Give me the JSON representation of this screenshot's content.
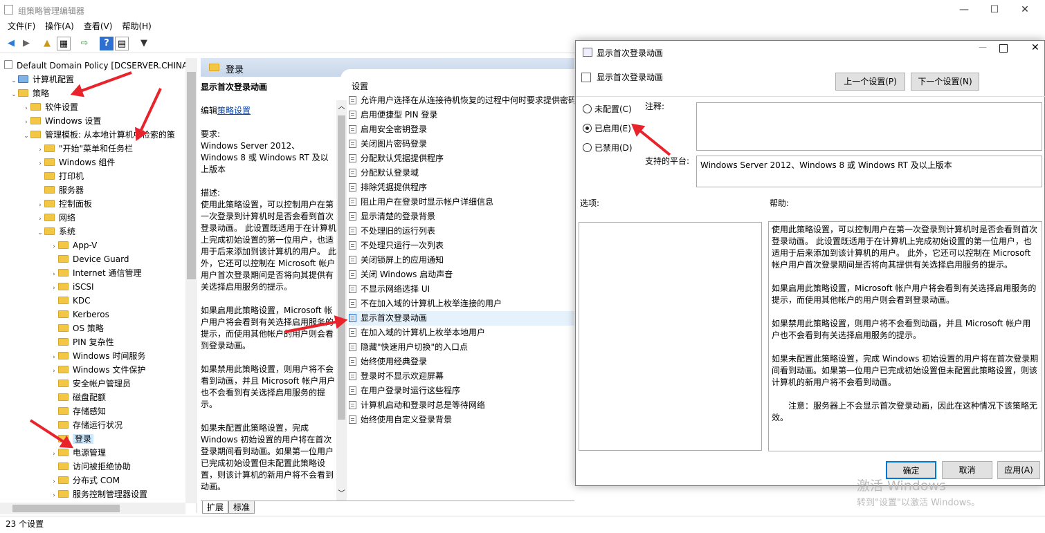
{
  "window": {
    "title": "组策略管理编辑器",
    "min": "—",
    "max": "☐",
    "close": "✕"
  },
  "menu": [
    "文件(F)",
    "操作(A)",
    "查看(V)",
    "帮助(H)"
  ],
  "toolbar_icons": [
    "back-icon",
    "forward-icon",
    "up-folder-icon",
    "show-hide-tree-icon",
    "export-icon",
    "help-icon",
    "properties-icon",
    "filter-icon"
  ],
  "tree": [
    {
      "label": "Default Domain Policy [DCSERVER.CHINA",
      "lvl": 0,
      "caret": "",
      "icon": "policy"
    },
    {
      "label": "计算机配置",
      "lvl": 0,
      "caret": "⌄",
      "icon": "computer"
    },
    {
      "label": "策略",
      "lvl": 1,
      "caret": "⌄",
      "icon": "folder"
    },
    {
      "label": "软件设置",
      "lvl": 2,
      "caret": "›",
      "icon": "folder"
    },
    {
      "label": "Windows 设置",
      "lvl": 2,
      "caret": "›",
      "icon": "folder"
    },
    {
      "label": "管理模板: 从本地计算机中检索的策",
      "lvl": 2,
      "caret": "⌄",
      "icon": "folder"
    },
    {
      "label": "\"开始\"菜单和任务栏",
      "lvl": 3,
      "caret": "›",
      "icon": "folder"
    },
    {
      "label": "Windows 组件",
      "lvl": 3,
      "caret": "›",
      "icon": "folder"
    },
    {
      "label": "打印机",
      "lvl": 3,
      "caret": "",
      "icon": "folder"
    },
    {
      "label": "服务器",
      "lvl": 3,
      "caret": "",
      "icon": "folder"
    },
    {
      "label": "控制面板",
      "lvl": 3,
      "caret": "›",
      "icon": "folder"
    },
    {
      "label": "网络",
      "lvl": 3,
      "caret": "›",
      "icon": "folder"
    },
    {
      "label": "系统",
      "lvl": 3,
      "caret": "⌄",
      "icon": "folder"
    },
    {
      "label": "App-V",
      "lvl": 4,
      "caret": "›",
      "icon": "folder"
    },
    {
      "label": "Device Guard",
      "lvl": 4,
      "caret": "",
      "icon": "folder"
    },
    {
      "label": "Internet 通信管理",
      "lvl": 4,
      "caret": "›",
      "icon": "folder"
    },
    {
      "label": "iSCSI",
      "lvl": 4,
      "caret": "›",
      "icon": "folder"
    },
    {
      "label": "KDC",
      "lvl": 4,
      "caret": "",
      "icon": "folder"
    },
    {
      "label": "Kerberos",
      "lvl": 4,
      "caret": "",
      "icon": "folder"
    },
    {
      "label": "OS 策略",
      "lvl": 4,
      "caret": "",
      "icon": "folder"
    },
    {
      "label": "PIN 复杂性",
      "lvl": 4,
      "caret": "",
      "icon": "folder"
    },
    {
      "label": "Windows 时间服务",
      "lvl": 4,
      "caret": "›",
      "icon": "folder"
    },
    {
      "label": "Windows 文件保护",
      "lvl": 4,
      "caret": "›",
      "icon": "folder"
    },
    {
      "label": "安全帐户管理员",
      "lvl": 4,
      "caret": "",
      "icon": "folder"
    },
    {
      "label": "磁盘配额",
      "lvl": 4,
      "caret": "",
      "icon": "folder"
    },
    {
      "label": "存储感知",
      "lvl": 4,
      "caret": "",
      "icon": "folder"
    },
    {
      "label": "存储运行状况",
      "lvl": 4,
      "caret": "",
      "icon": "folder"
    },
    {
      "label": "登录",
      "lvl": 4,
      "caret": "",
      "icon": "folder",
      "selected": true
    },
    {
      "label": "电源管理",
      "lvl": 4,
      "caret": "›",
      "icon": "folder"
    },
    {
      "label": "访问被拒绝协助",
      "lvl": 4,
      "caret": "",
      "icon": "folder"
    },
    {
      "label": "分布式 COM",
      "lvl": 4,
      "caret": "›",
      "icon": "folder"
    },
    {
      "label": "服务控制管理器设置",
      "lvl": 4,
      "caret": "›",
      "icon": "folder"
    }
  ],
  "middle": {
    "header": "登录",
    "desc_title": "显示首次登录动画",
    "edit_prefix": "编辑",
    "edit_link": "策略设置",
    "req_label": "要求:",
    "req_text": "Windows Server 2012、Windows 8 或 Windows RT 及以上版本",
    "desc_label": "描述:",
    "desc_paras": [
      "使用此策略设置，可以控制用户在第一次登录到计算机时是否会看到首次登录动画。 此设置既适用于在计算机上完成初始设置的第一位用户，也适用于后来添加到该计算机的用户。 此外，它还可以控制在 Microsoft 帐户用户首次登录期间是否将向其提供有关选择启用服务的提示。",
      "如果启用此策略设置，Microsoft 帐户用户将会看到有关选择启用服务的提示，而使用其他帐户的用户则会看到登录动画。",
      "如果禁用此策略设置，则用户将不会看到动画，并且 Microsoft 帐户用户也不会看到有关选择启用服务的提示。",
      "如果未配置此策略设置，完成 Windows 初始设置的用户将在首次登录期间看到动画。如果第一位用户已完成初始设置但未配置此策略设置，则该计算机的新用户将不会看到动画。"
    ],
    "list_header": "设置",
    "settings": [
      "允许用户选择在从连接待机恢复的过程中何时要求提供密码",
      "启用便捷型 PIN 登录",
      "启用安全密钥登录",
      "关闭图片密码登录",
      "分配默认凭据提供程序",
      "分配默认登录域",
      "排除凭据提供程序",
      "阻止用户在登录时显示帐户详细信息",
      "显示清楚的登录背景",
      "不处理旧的运行列表",
      "不处理只运行一次列表",
      "关闭锁屏上的应用通知",
      "关闭 Windows 启动声音",
      "不显示网络选择 UI",
      "不在加入域的计算机上枚举连接的用户",
      "显示首次登录动画",
      "在加入域的计算机上枚举本地用户",
      "隐藏\"快速用户切换\"的入口点",
      "始终使用经典登录",
      "登录时不显示欢迎屏幕",
      "在用户登录时运行这些程序",
      "计算机启动和登录时总是等待网络",
      "始终使用自定义登录背景"
    ],
    "selected_index": 15,
    "tabs": [
      "扩展",
      "标准"
    ]
  },
  "status": "23 个设置",
  "dialog": {
    "title": "显示首次登录动画",
    "subtitle": "显示首次登录动画",
    "prev": "上一个设置(P)",
    "next": "下一个设置(N)",
    "radios": [
      "未配置(C)",
      "已启用(E)",
      "已禁用(D)"
    ],
    "selected_radio": 1,
    "comment_label": "注释:",
    "platform_label": "支持的平台:",
    "platform_text": "Windows Server 2012、Windows 8 或 Windows RT 及以上版本",
    "options_label": "选项:",
    "help_label": "帮助:",
    "help_paras": [
      "使用此策略设置，可以控制用户在第一次登录到计算机时是否会看到首次登录动画。 此设置既适用于在计算机上完成初始设置的第一位用户，也适用于后来添加到该计算机的用户。 此外，它还可以控制在 Microsoft 帐户用户首次登录期间是否将向其提供有关选择启用服务的提示。",
      "如果启用此策略设置，Microsoft 帐户用户将会看到有关选择启用服务的提示，而使用其他帐户的用户则会看到登录动画。",
      "如果禁用此策略设置，则用户将不会看到动画，并且 Microsoft 帐户用户也不会看到有关选择启用服务的提示。",
      "如果未配置此策略设置，完成 Windows 初始设置的用户将在首次登录期间看到动画。如果第一位用户已完成初始设置但未配置此策略设置，则该计算机的新用户将不会看到动画。",
      "　　注意：服务器上不会显示首次登录动画，因此在这种情况下该策略无效。"
    ],
    "ok": "确定",
    "cancel": "取消",
    "apply": "应用(A)"
  },
  "watermark": {
    "line1": "激活 Windows",
    "line2": "转到\"设置\"以激活 Windows。"
  },
  "colors": {
    "accent": "#0078d7",
    "arrow": "#e8232b",
    "selection": "#cce8ff"
  }
}
